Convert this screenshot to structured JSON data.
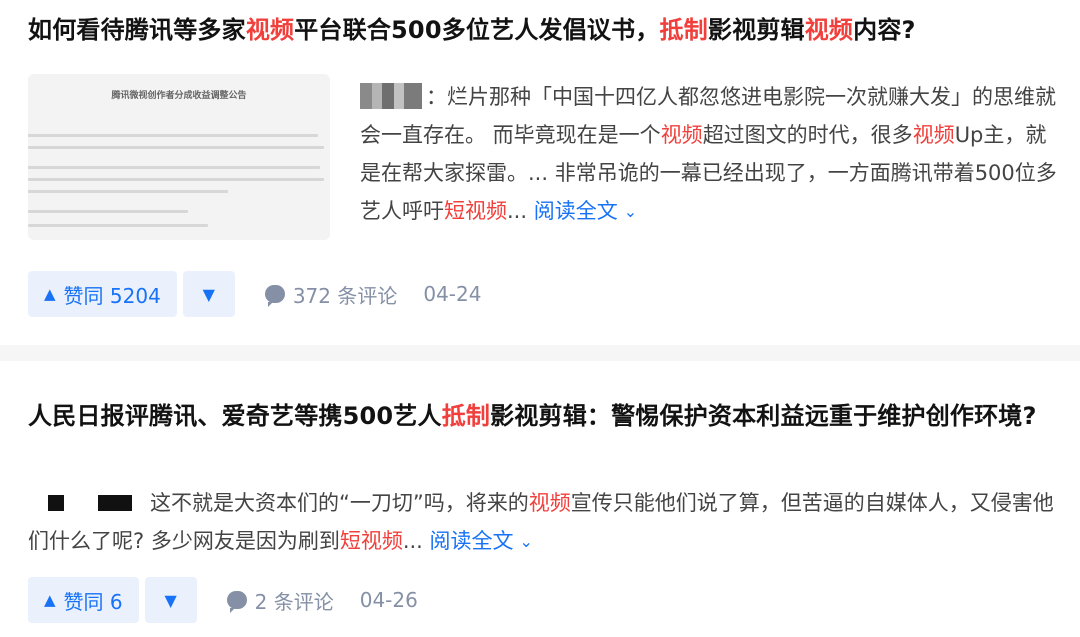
{
  "cards": [
    {
      "title_segments": [
        {
          "text": "如何看待腾讯等多家",
          "hl": false
        },
        {
          "text": "视频",
          "hl": true
        },
        {
          "text": "平台联合500多位艺人发倡议书，",
          "hl": false
        },
        {
          "text": "抵制",
          "hl": true
        },
        {
          "text": "影视剪辑",
          "hl": false
        },
        {
          "text": "视频",
          "hl": true
        },
        {
          "text": "内容?",
          "hl": false
        }
      ],
      "thumbnail_title": "腾讯微视创作者分成收益调整公告",
      "excerpt_segments": [
        {
          "text": "：烂片那种「中国十四亿人都忽悠进电影院一次就赚大发」的思维就会一直存在。 而毕竟现在是一个",
          "hl": false
        },
        {
          "text": "视频",
          "hl": true
        },
        {
          "text": "超过图文的时代，很多",
          "hl": false
        },
        {
          "text": "视频",
          "hl": true
        },
        {
          "text": "Up主，就是在帮大家探雷。... 非常吊诡的一幕已经出现了，一方面腾讯带着500位多艺人呼吁",
          "hl": false
        },
        {
          "text": "短视频",
          "hl": true
        },
        {
          "text": "...",
          "hl": false
        }
      ],
      "read_more": "阅读全文",
      "upvote": "赞同 5204",
      "comments": "372 条评论",
      "date": "04-24"
    },
    {
      "title_segments": [
        {
          "text": "人民日报评腾讯、爱奇艺等携500艺人",
          "hl": false
        },
        {
          "text": "抵制",
          "hl": true
        },
        {
          "text": "影视剪辑：警惕保护资本利益远重于维护创作环境?",
          "hl": false
        }
      ],
      "excerpt_segments": [
        {
          "text": "这不就是大资本们的“一刀切”吗，将来的",
          "hl": false
        },
        {
          "text": "视频",
          "hl": true
        },
        {
          "text": "宣传只能他们说了算，但苦逼的自媒体人，又侵害他们什么了呢? 多少网友是因为刷到",
          "hl": false
        },
        {
          "text": "短视频",
          "hl": true
        },
        {
          "text": "...",
          "hl": false
        }
      ],
      "read_more": "阅读全文",
      "upvote": "赞同 6",
      "comments": "2 条评论",
      "date": "04-26"
    }
  ],
  "icons": {
    "upvote": "triangle-up-icon",
    "downvote": "triangle-down-icon",
    "comment": "comment-bubble-icon",
    "expand": "chevron-down-icon"
  },
  "colors": {
    "highlight": "#f1403c",
    "link": "#1772f6",
    "vote_bg": "#eaf1fd",
    "meta": "#8590a6"
  }
}
